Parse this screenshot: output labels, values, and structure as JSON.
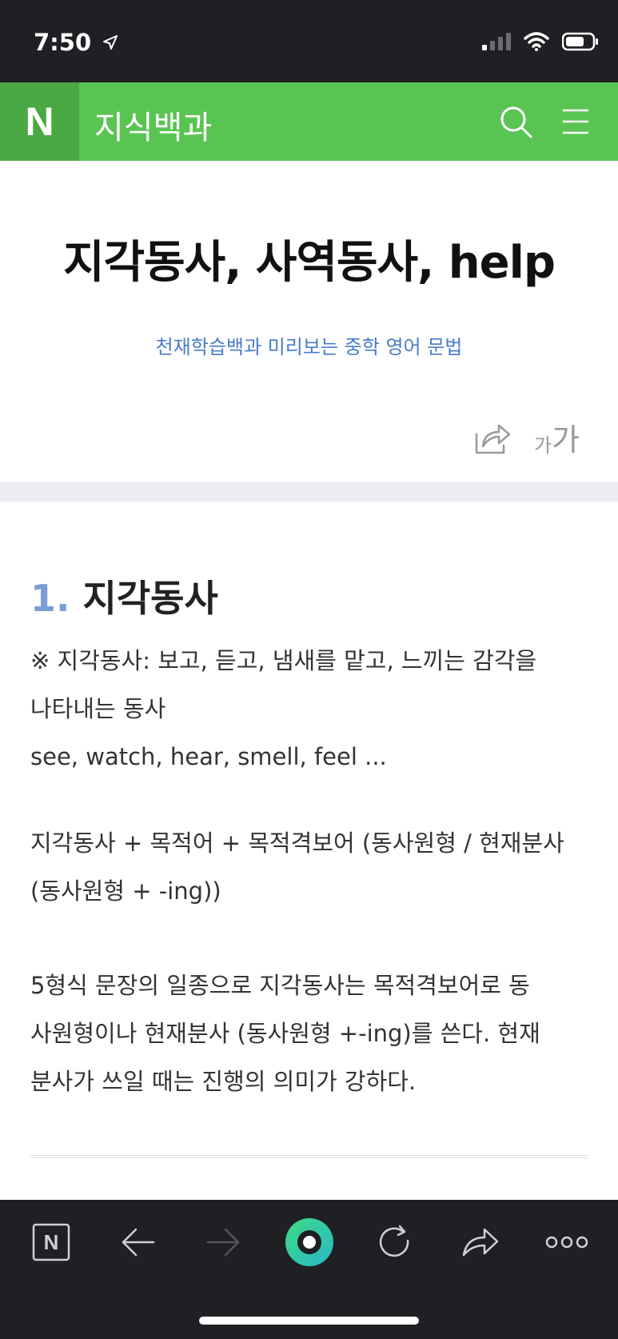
{
  "status": {
    "time": "7:50"
  },
  "appbar": {
    "logo": "N",
    "title": "지식백과"
  },
  "article": {
    "title": "지각동사, 사역동사, help",
    "source": "천재학습백과 미리보는 중학 영어 문법",
    "fontsize_small": "가",
    "fontsize_large": "가"
  },
  "section": {
    "number": "1.",
    "heading": "지각동사",
    "paragraphs": [
      [
        "※ 지각동사: 보고, 듣고, 냄새를 맡고, 느끼는 감각을",
        "나타내는 동사",
        "see, watch, hear, smell, feel ..."
      ],
      [
        "지각동사 + 목적어 + 목적격보어 (동사원형 / 현재분사",
        "(동사원형 + -ing))"
      ],
      [
        "5형식 문장의 일종으로 지각동사는 목적격보어로 동",
        "사원형이나 현재분사 (동사원형 +-ing)를 쓴다. 현재",
        "분사가 쓰일 때는 진행의 의미가 강하다."
      ]
    ]
  },
  "toolbar": {
    "home_label": "N"
  },
  "colors": {
    "brand_green": "#5ac452",
    "brand_green_dark": "#4aa843",
    "link_blue": "#4a7bc8",
    "section_number": "#7a9dd6",
    "bar_dark": "#1f1f24"
  },
  "icons": [
    "location-arrow-icon",
    "signal-icon",
    "wifi-icon",
    "battery-icon",
    "search-icon",
    "menu-icon",
    "share-icon",
    "back-arrow-icon",
    "forward-arrow-icon",
    "green-dot-icon",
    "reload-icon",
    "more-icon"
  ]
}
